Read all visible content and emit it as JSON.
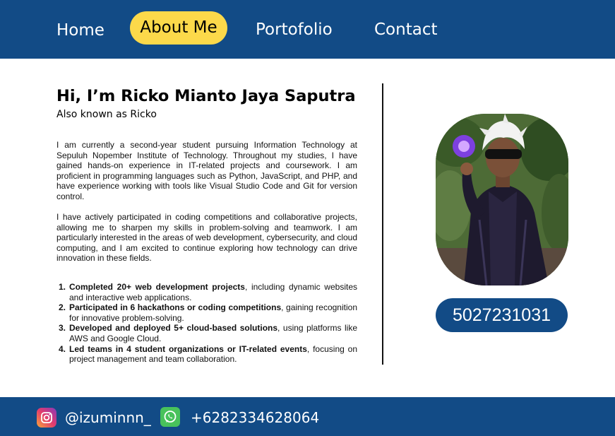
{
  "nav": {
    "items": [
      {
        "label": "Home"
      },
      {
        "label": "About Me",
        "active": true
      },
      {
        "label": "Portofolio"
      },
      {
        "label": "Contact"
      }
    ]
  },
  "intro": {
    "greeting": "Hi, I’m Ricko Mianto Jaya Saputra",
    "aka": "Also known as Ricko"
  },
  "bio": {
    "paragraph1": "I am currently a second-year student pursuing Information Technology at Sepuluh Nopember Institute of Technology. Throughout my studies, I have gained hands-on experience in IT-related projects and coursework. I am proficient in programming languages such as Python, JavaScript, and PHP, and have experience working with tools like Visual Studio Code and Git for version control.",
    "paragraph2": "I have actively participated in coding competitions and collaborative projects, allowing me to sharpen my skills in problem-solving and teamwork. I am particularly interested in the areas of web development, cybersecurity, and cloud computing, and I am excited to continue exploring how technology can drive innovation in these fields."
  },
  "achievements": [
    {
      "num": "1.",
      "bold": "Completed 20+ web development projects",
      "rest": ", including dynamic websites and interactive web applications."
    },
    {
      "num": "2.",
      "bold": "Participated in 6 hackathons or coding competitions",
      "rest": ", gaining recognition for innovative problem-solving."
    },
    {
      "num": "3.",
      "bold": "Developed and deployed 5+ cloud-based solutions",
      "rest": ", using platforms like AWS and Google Cloud."
    },
    {
      "num": "4.",
      "bold": "Led teams in 4 student organizations or IT-related events",
      "rest": ", focusing on project management and team collaboration."
    }
  ],
  "profile": {
    "student_id": "5027231031"
  },
  "footer": {
    "instagram": "@izuminnn_",
    "whatsapp": "+6282334628064"
  },
  "colors": {
    "primary": "#124b86",
    "accent": "#fcd94a"
  },
  "icons": [
    "instagram-icon",
    "whatsapp-icon"
  ]
}
